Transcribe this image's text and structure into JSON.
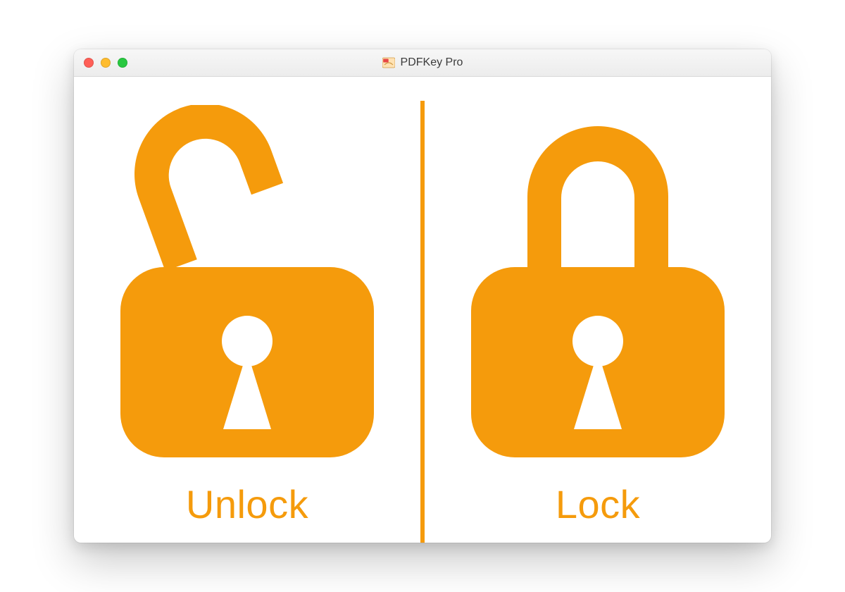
{
  "window": {
    "title": "PDFKey Pro",
    "traffic_light_close": "close",
    "traffic_light_minimize": "minimize",
    "traffic_light_zoom": "zoom"
  },
  "theme": {
    "accent": "#f59b0c"
  },
  "panes": {
    "left": {
      "label": "Unlock",
      "icon": "unlock-icon"
    },
    "right": {
      "label": "Lock",
      "icon": "lock-icon"
    }
  }
}
